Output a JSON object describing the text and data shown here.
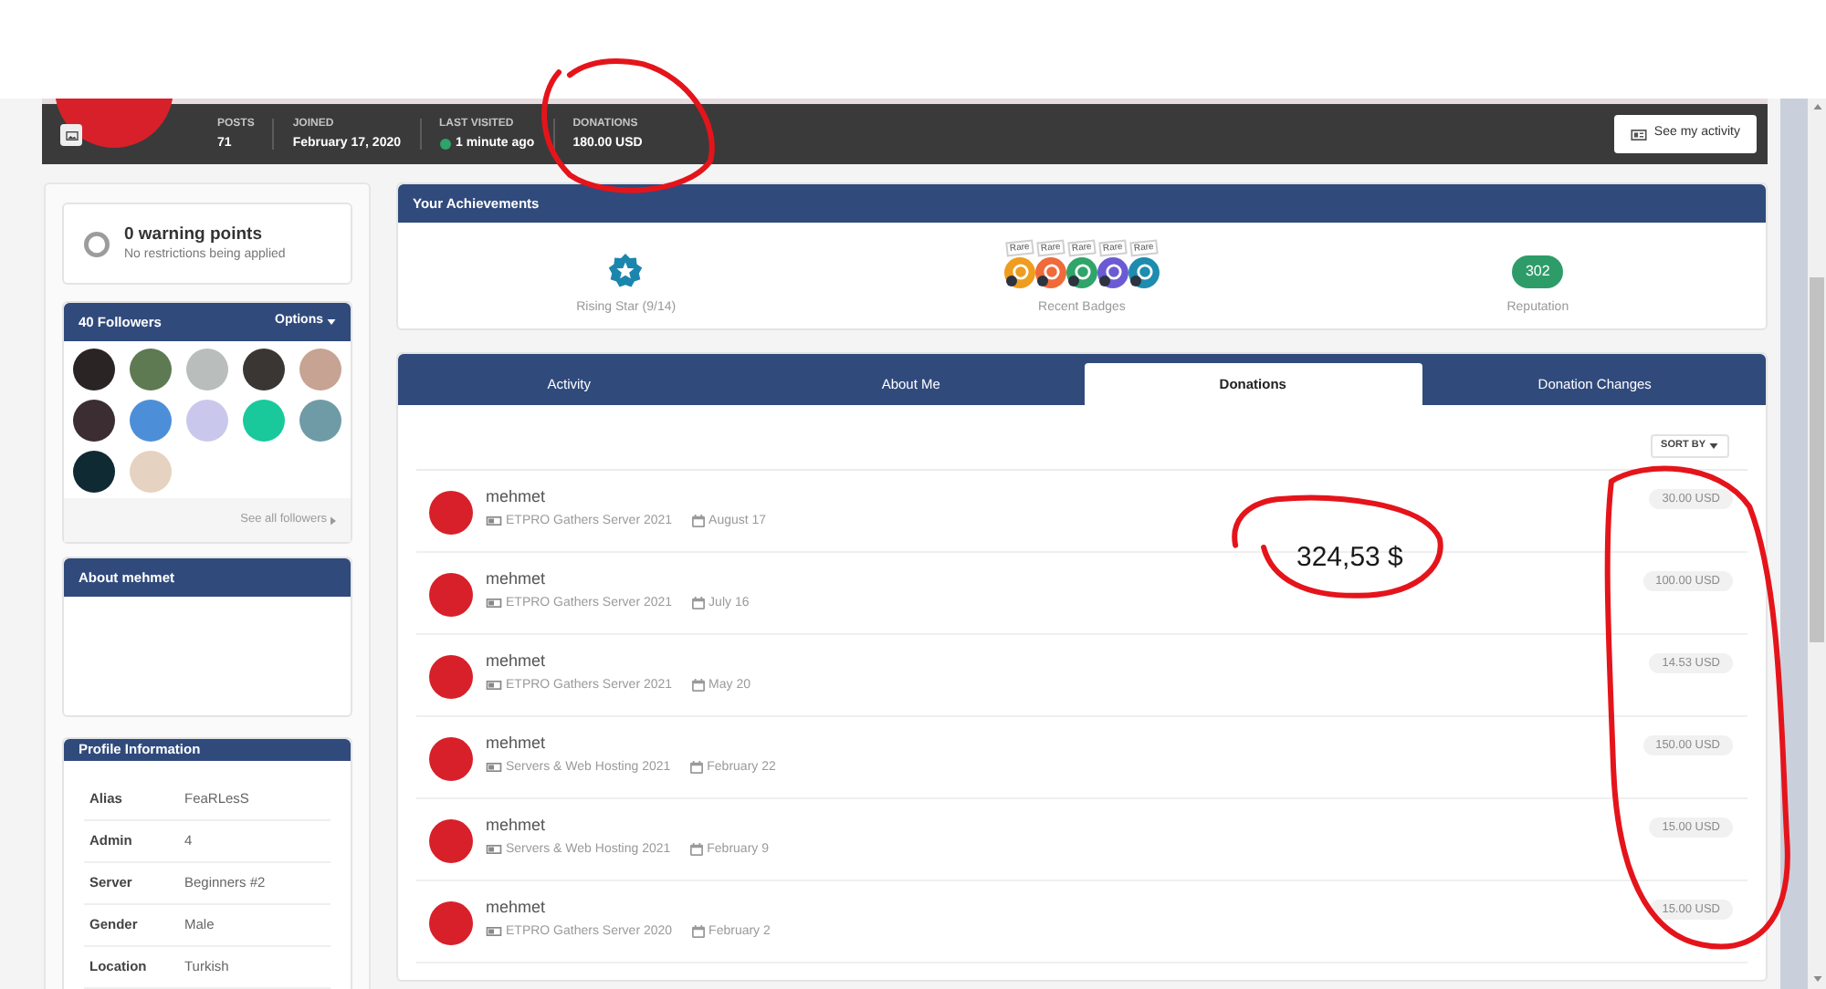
{
  "header": {
    "stats": [
      {
        "label": "POSTS",
        "value": "71"
      },
      {
        "label": "JOINED",
        "value": "February 17, 2020"
      },
      {
        "label": "LAST VISITED",
        "value": "1 minute ago",
        "online": true
      },
      {
        "label": "DONATIONS",
        "value": "180.00 USD"
      }
    ],
    "activity_button": "See my activity"
  },
  "warning": {
    "title": "0 warning points",
    "subtitle": "No restrictions being applied"
  },
  "followers": {
    "title": "40 Followers",
    "options": "Options",
    "avatars": [
      {
        "color": "#2b2424"
      },
      {
        "color": "#5d7a52"
      },
      {
        "color": "#b9bdbb"
      },
      {
        "color": "#3a3634"
      },
      {
        "color": "#c7a393"
      },
      {
        "color": "#3b2d31"
      },
      {
        "color": "#4c8fd8"
      },
      {
        "color": "#c9c8ec"
      },
      {
        "color": "#19c99b"
      },
      {
        "color": "#6f9ba6"
      },
      {
        "color": "#0f2a33"
      },
      {
        "color": "#e6d2c0"
      }
    ],
    "see_all": "See all followers"
  },
  "about": {
    "title": "About mehmet"
  },
  "profile_information": {
    "title": "Profile Information",
    "fields": [
      {
        "label": "Alias",
        "value": "FeaRLesS"
      },
      {
        "label": "Admin",
        "value": "4"
      },
      {
        "label": "Server",
        "value": "Beginners #2"
      },
      {
        "label": "Gender",
        "value": "Male"
      },
      {
        "label": "Location",
        "value": "Turkish"
      }
    ]
  },
  "achievements": {
    "title": "Your Achievements",
    "items": [
      {
        "kind": "rank",
        "caption": "Rising Star (9/14)"
      },
      {
        "kind": "badges",
        "caption": "Recent Badges",
        "badges": [
          {
            "tag": "Rare",
            "color": "#ee9d1f"
          },
          {
            "tag": "Rare",
            "color": "#f06a3a"
          },
          {
            "tag": "Rare",
            "color": "#2fa56a"
          },
          {
            "tag": "Rare",
            "color": "#6a5bd4"
          },
          {
            "tag": "Rare",
            "color": "#1d8cae"
          }
        ]
      },
      {
        "kind": "reputation",
        "value": "302",
        "caption": "Reputation"
      }
    ]
  },
  "tabs": [
    {
      "label": "Activity",
      "selected": false
    },
    {
      "label": "About Me",
      "selected": false
    },
    {
      "label": "Donations",
      "selected": true
    },
    {
      "label": "Donation Changes",
      "selected": false
    }
  ],
  "sort_button": "SORT BY",
  "donations": [
    {
      "name": "mehmet",
      "category": "ETPRO Gathers Server 2021",
      "date": "August 17",
      "amount": "30.00 USD"
    },
    {
      "name": "mehmet",
      "category": "ETPRO Gathers Server 2021",
      "date": "July 16",
      "amount": "100.00 USD"
    },
    {
      "name": "mehmet",
      "category": "ETPRO Gathers Server 2021",
      "date": "May 20",
      "amount": "14.53 USD"
    },
    {
      "name": "mehmet",
      "category": "Servers & Web Hosting 2021",
      "date": "February 22",
      "amount": "150.00 USD"
    },
    {
      "name": "mehmet",
      "category": "Servers & Web Hosting 2021",
      "date": "February 9",
      "amount": "15.00 USD"
    },
    {
      "name": "mehmet",
      "category": "ETPRO Gathers Server 2020",
      "date": "February 2",
      "amount": "15.00 USD"
    }
  ],
  "annotation": {
    "note": "324,53 $"
  }
}
